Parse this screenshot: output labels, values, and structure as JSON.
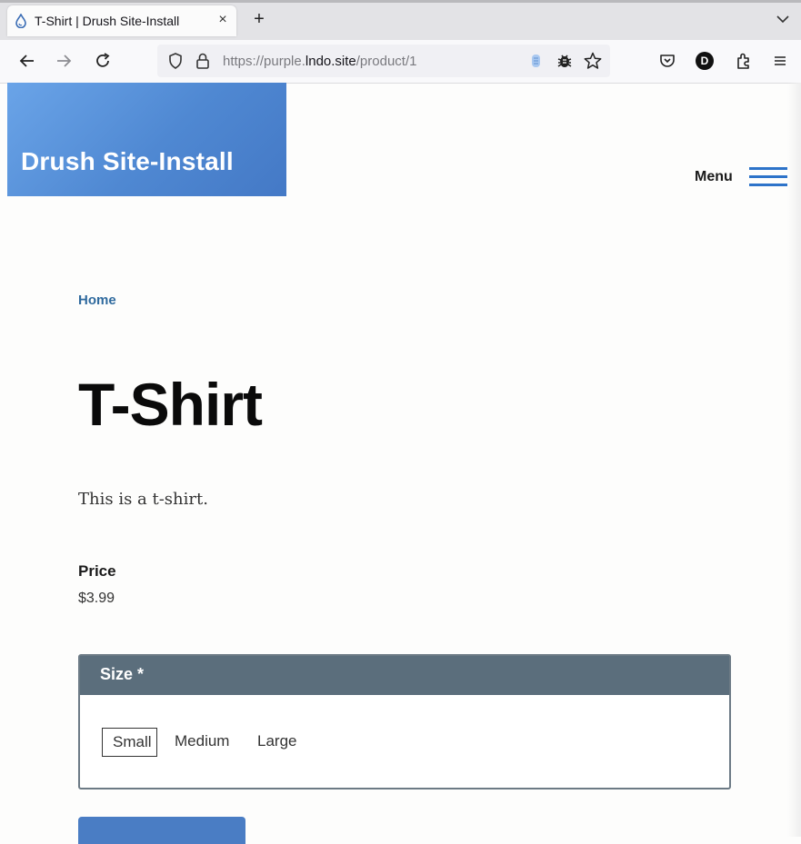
{
  "browser": {
    "tab": {
      "title": "T-Shirt | Drush Site-Install",
      "close": "×",
      "icon": "drupal-drop-icon"
    },
    "new_tab": "+",
    "url": {
      "prefix": "https://purple.",
      "host": "lndo.site",
      "path": "/product/1"
    },
    "icons": [
      "back-arrow-icon",
      "forward-arrow-icon",
      "reload-icon",
      "shield-icon",
      "lock-icon",
      "extension-icon",
      "bug-icon",
      "star-icon",
      "pocket-icon",
      "profile-icon",
      "extensions-icon",
      "menu-icon"
    ],
    "profile_letter": "D"
  },
  "site": {
    "name": "Drush Site-Install",
    "menu_label": "Menu",
    "brand_color": "#4f88d2"
  },
  "breadcrumb": {
    "home": "Home"
  },
  "product": {
    "title": "T-Shirt",
    "description": "This is a t-shirt.",
    "price_label": "Price",
    "price_value": "$3.99"
  },
  "size_field": {
    "legend": "Size *",
    "options": [
      "Small",
      "Medium",
      "Large"
    ],
    "selected": "Small"
  }
}
